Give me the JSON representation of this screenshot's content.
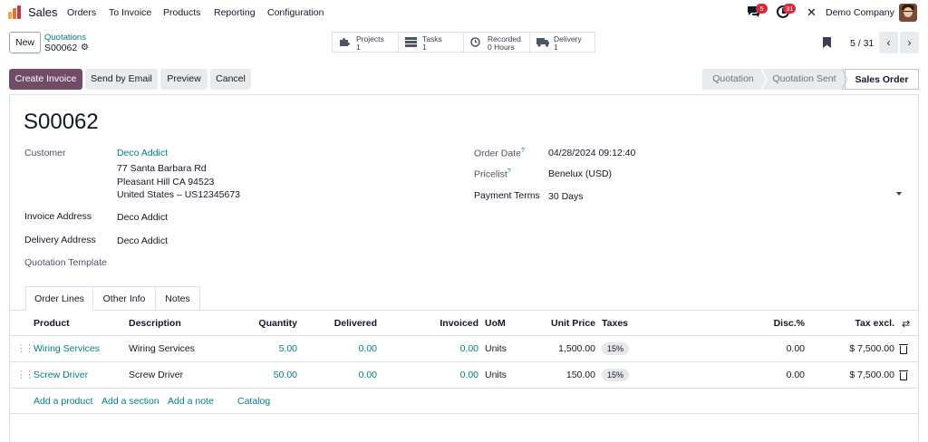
{
  "app": {
    "name": "Sales",
    "nav": [
      "Orders",
      "To Invoice",
      "Products",
      "Reporting",
      "Configuration"
    ],
    "chat_badge": "5",
    "activity_badge": "31",
    "company": "Demo Company",
    "logo_colors": [
      "#f3a83b",
      "#e56d3b",
      "#c7354a"
    ]
  },
  "control": {
    "new_label": "New",
    "breadcrumb_parent": "Quotations",
    "breadcrumb_current": "S00062",
    "pager": "5 / 31"
  },
  "stats": [
    {
      "icon": "puzzle-icon",
      "label": "Projects",
      "value": "1"
    },
    {
      "icon": "tasks-icon",
      "label": "Tasks",
      "value": "1"
    },
    {
      "icon": "clock-icon",
      "label": "Recorded",
      "value": "0 Hours"
    },
    {
      "icon": "truck-icon",
      "label": "Delivery",
      "value": "1"
    }
  ],
  "actions": {
    "create_invoice": "Create Invoice",
    "send_email": "Send by Email",
    "preview": "Preview",
    "cancel": "Cancel"
  },
  "status_steps": [
    "Quotation",
    "Quotation Sent",
    "Sales Order"
  ],
  "status_current": "Sales Order",
  "record": {
    "name": "S00062",
    "customer_label": "Customer",
    "customer": "Deco Addict",
    "address_line1": "77 Santa Barbara Rd",
    "address_line2": "Pleasant Hill CA 94523",
    "address_line3": "United States – US12345673",
    "invoice_address_label": "Invoice Address",
    "invoice_address": "Deco Addict",
    "delivery_address_label": "Delivery Address",
    "delivery_address": "Deco Addict",
    "quotation_template_label": "Quotation Template",
    "order_date_label": "Order Date",
    "order_date": "04/28/2024 09:12:40",
    "pricelist_label": "Pricelist",
    "pricelist": "Benelux (USD)",
    "payment_terms_label": "Payment Terms",
    "payment_terms": "30 Days",
    "help_mark": "?"
  },
  "tabs": [
    "Order Lines",
    "Other Info",
    "Notes"
  ],
  "table": {
    "headers": [
      "Product",
      "Description",
      "Quantity",
      "Delivered",
      "Invoiced",
      "UoM",
      "Unit Price",
      "Taxes",
      "Disc.%",
      "Tax excl."
    ],
    "rows": [
      {
        "product": "Wiring Services",
        "description": "Wiring Services",
        "quantity": "5.00",
        "delivered": "0.00",
        "invoiced": "0.00",
        "uom": "Units",
        "unit_price": "1,500.00",
        "taxes": "15%",
        "discount": "0.00",
        "subtotal": "$ 7,500.00"
      },
      {
        "product": "Screw Driver",
        "description": "Screw Driver",
        "quantity": "50.00",
        "delivered": "0.00",
        "invoiced": "0.00",
        "uom": "Units",
        "unit_price": "150.00",
        "taxes": "15%",
        "discount": "0.00",
        "subtotal": "$ 7,500.00"
      }
    ],
    "add_links": [
      "Add a product",
      "Add a section",
      "Add a note",
      "Catalog"
    ]
  }
}
